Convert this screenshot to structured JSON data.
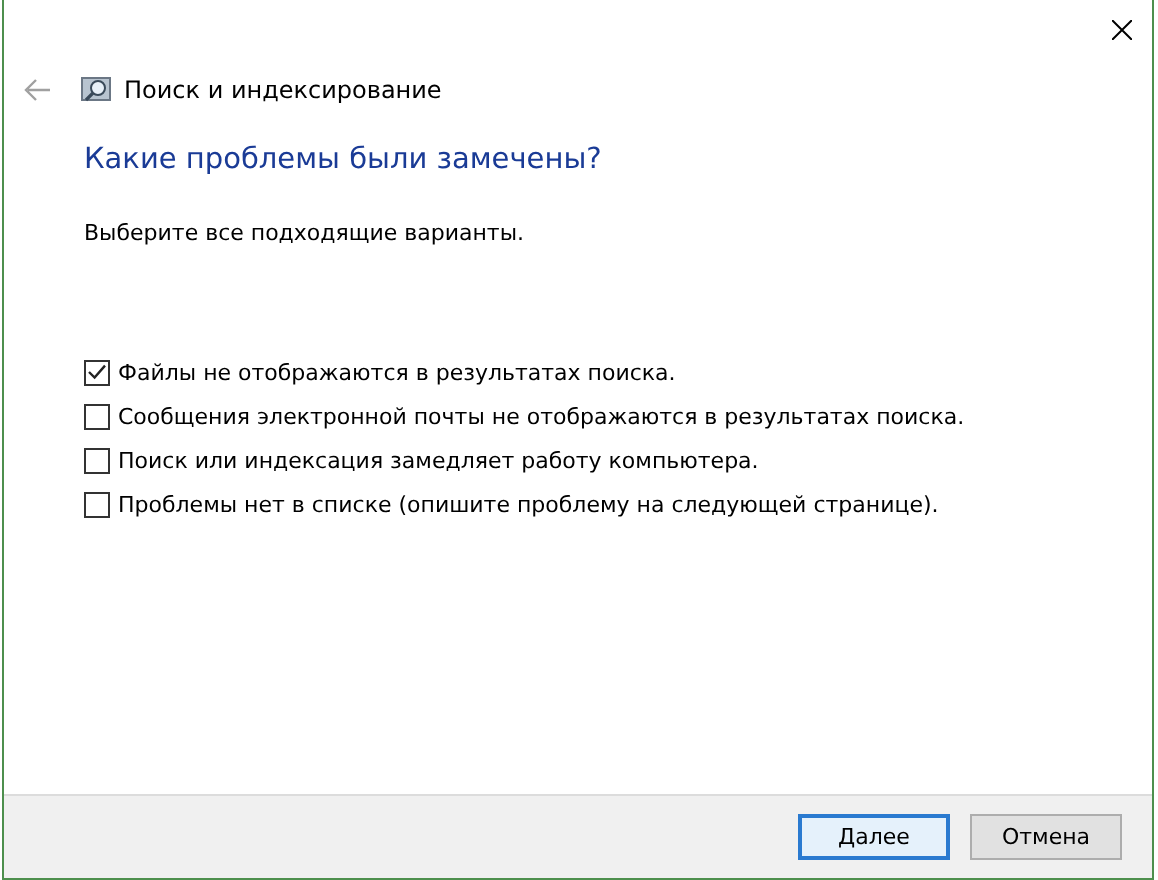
{
  "window": {
    "title": "Поиск и индексирование"
  },
  "heading": "Какие проблемы были замечены?",
  "instruction": "Выберите все подходящие варианты.",
  "options": [
    {
      "label": "Файлы не отображаются в результатах поиска.",
      "checked": true
    },
    {
      "label": "Сообщения электронной почты не отображаются в результатах поиска.",
      "checked": false
    },
    {
      "label": "Поиск или индексация замедляет работу компьютера.",
      "checked": false
    },
    {
      "label": "Проблемы нет в списке (опишите проблему на следующей странице).",
      "checked": false
    }
  ],
  "buttons": [
    {
      "label": "Далее",
      "kind": "default"
    },
    {
      "label": "Отмена",
      "kind": "normal"
    }
  ]
}
